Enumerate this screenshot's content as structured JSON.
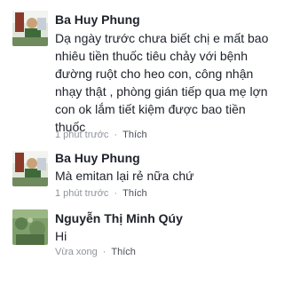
{
  "comments": [
    {
      "author": "Ba Huy Phung",
      "text": "Dạ ngày trước chưa biết chị e mất bao nhiêu tiền thuốc tiêu chảy với bệnh đường ruột cho heo con, công nhận nhạy thật , phòng gián tiếp qua mẹ lợn con ok lắm tiết kiệm được bao tiền thuốc",
      "time": "1 phút trước",
      "separator": "·",
      "like": "Thích",
      "avatar_icon": "profile-photo"
    },
    {
      "author": "Ba Huy Phung",
      "text": "Mà emitan lại rẻ nữa chứ",
      "time": "1 phút trước",
      "separator": "·",
      "like": "Thích",
      "avatar_icon": "profile-photo"
    },
    {
      "author": "Nguyễn Thị Minh Qúy",
      "text": "Hi",
      "time": "Vừa xong",
      "separator": "·",
      "like": "Thích",
      "avatar_icon": "profile-photo-green"
    }
  ]
}
